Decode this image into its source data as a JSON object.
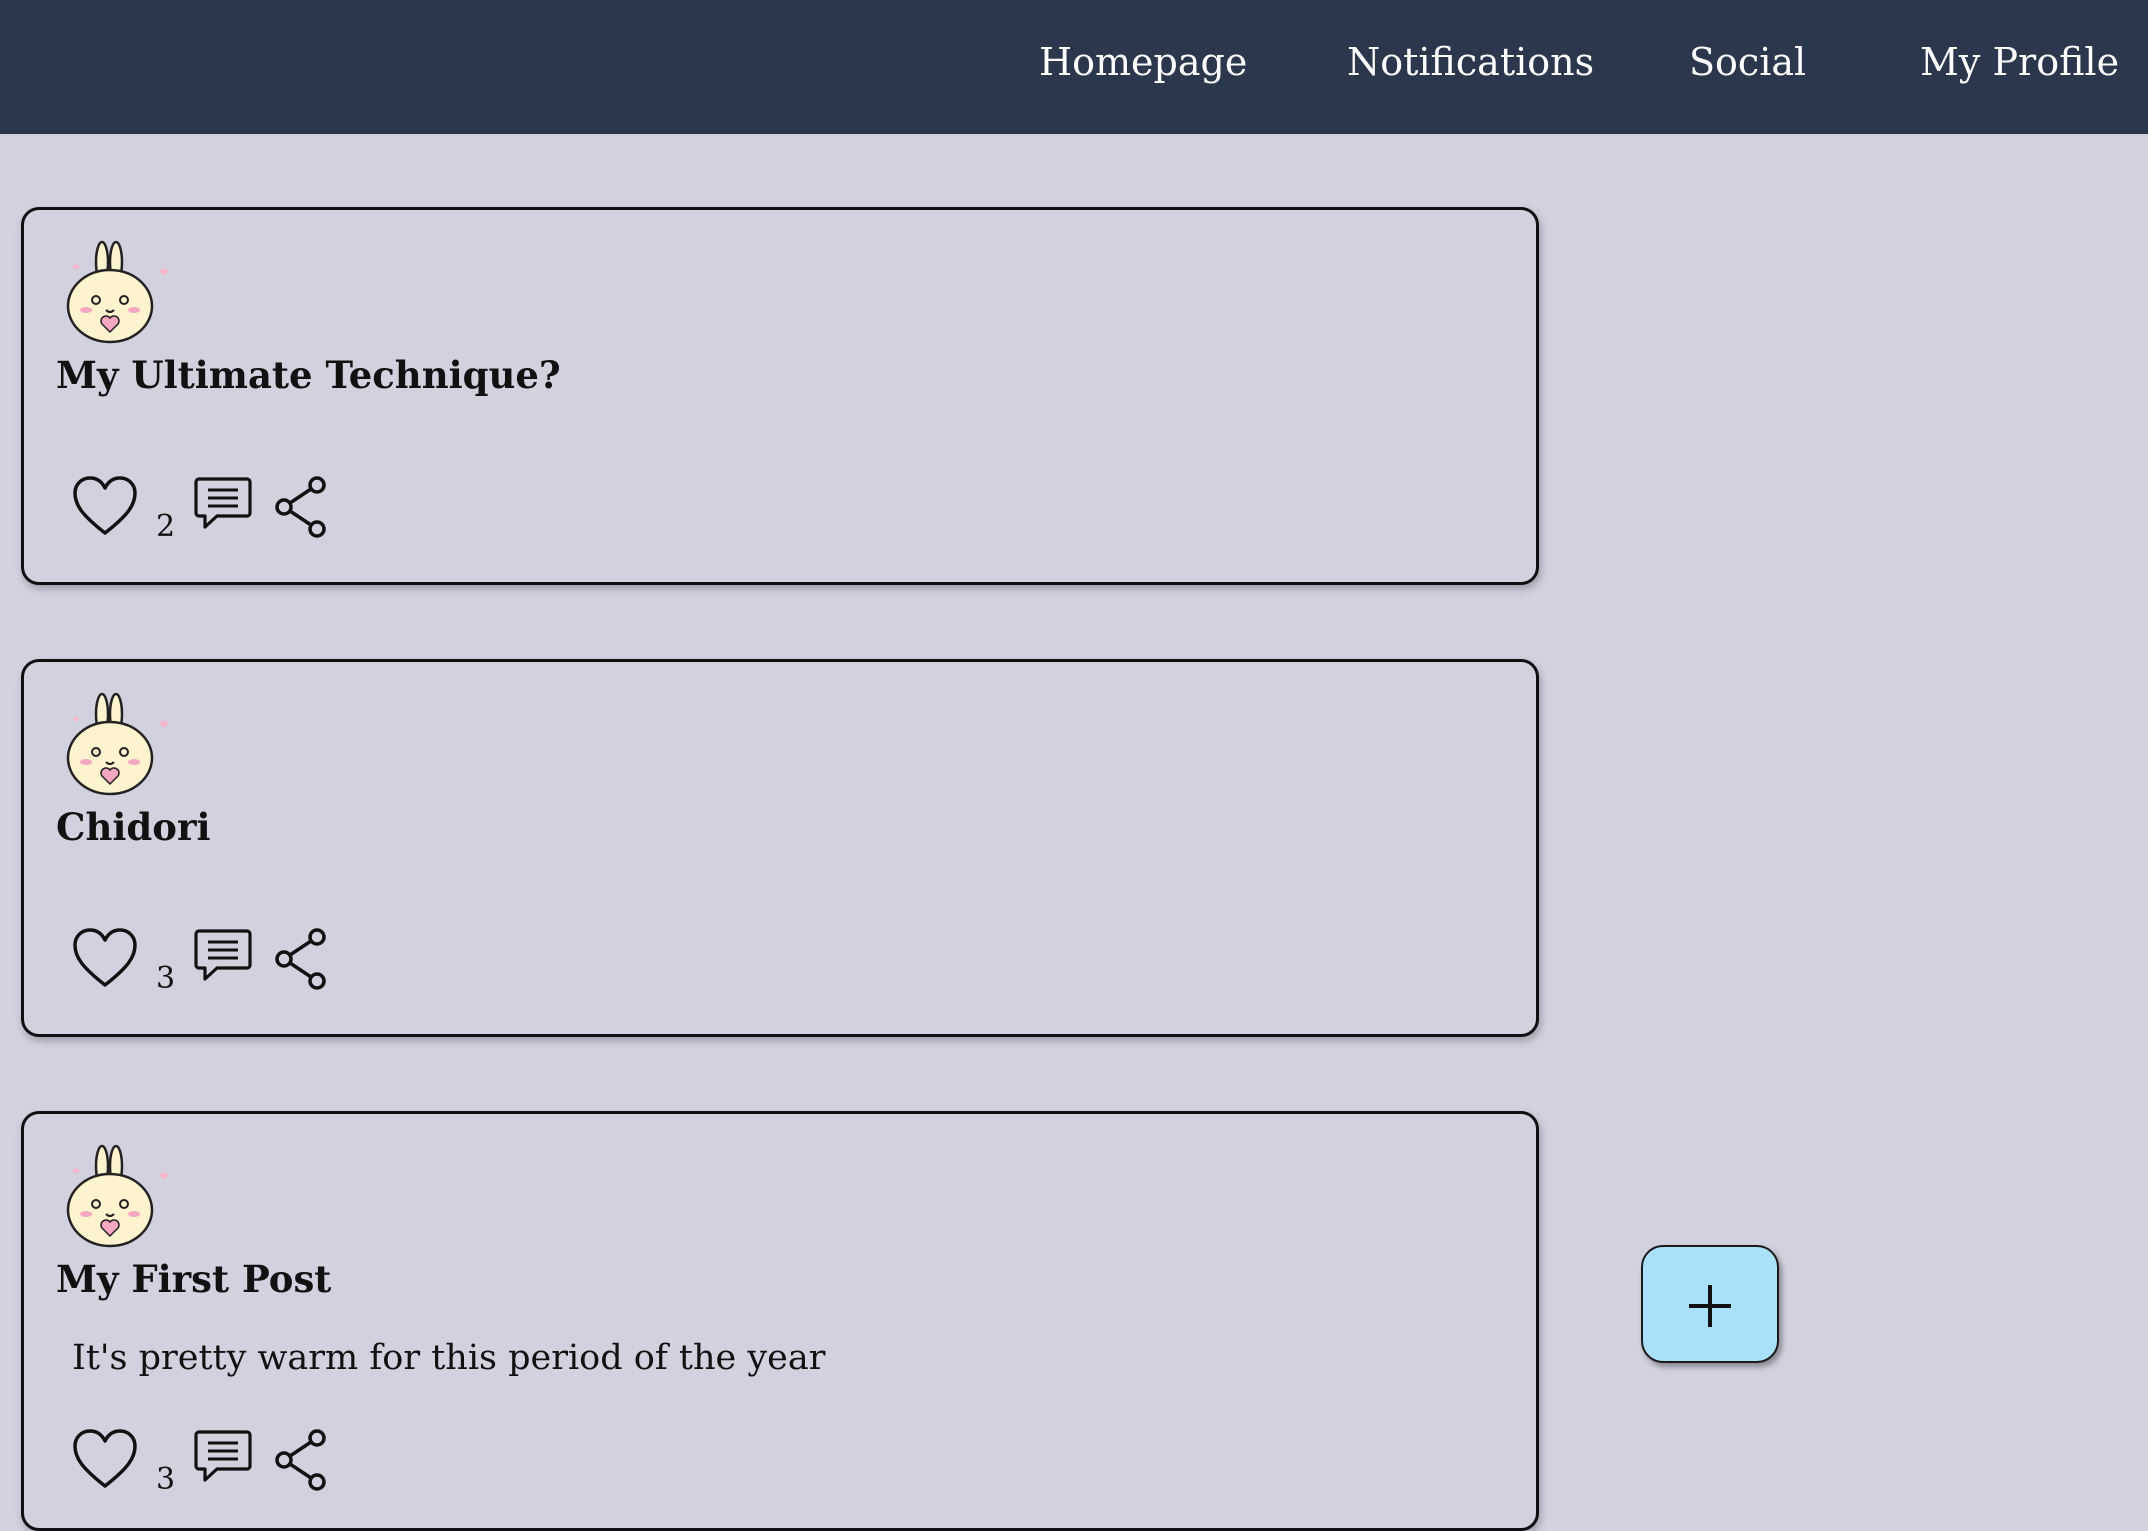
{
  "nav": {
    "items": [
      {
        "label": "Homepage"
      },
      {
        "label": "Notifications"
      },
      {
        "label": "Social"
      },
      {
        "label": "My Profile"
      }
    ]
  },
  "posts": [
    {
      "title": "My Ultimate Technique?",
      "body": "",
      "likes": "2"
    },
    {
      "title": "Chidori",
      "body": "",
      "likes": "3"
    },
    {
      "title": "My First Post",
      "body": "It's pretty warm for this period of the year",
      "likes": "3"
    }
  ],
  "icons": {
    "like": "heart-icon",
    "comment": "comment-icon",
    "share": "share-icon",
    "avatar": "bunny-avatar-icon",
    "fab": "plus-icon"
  },
  "colors": {
    "topbar": "#2b374c",
    "background": "#d2d1e0",
    "fab": "#a9e1fa"
  }
}
